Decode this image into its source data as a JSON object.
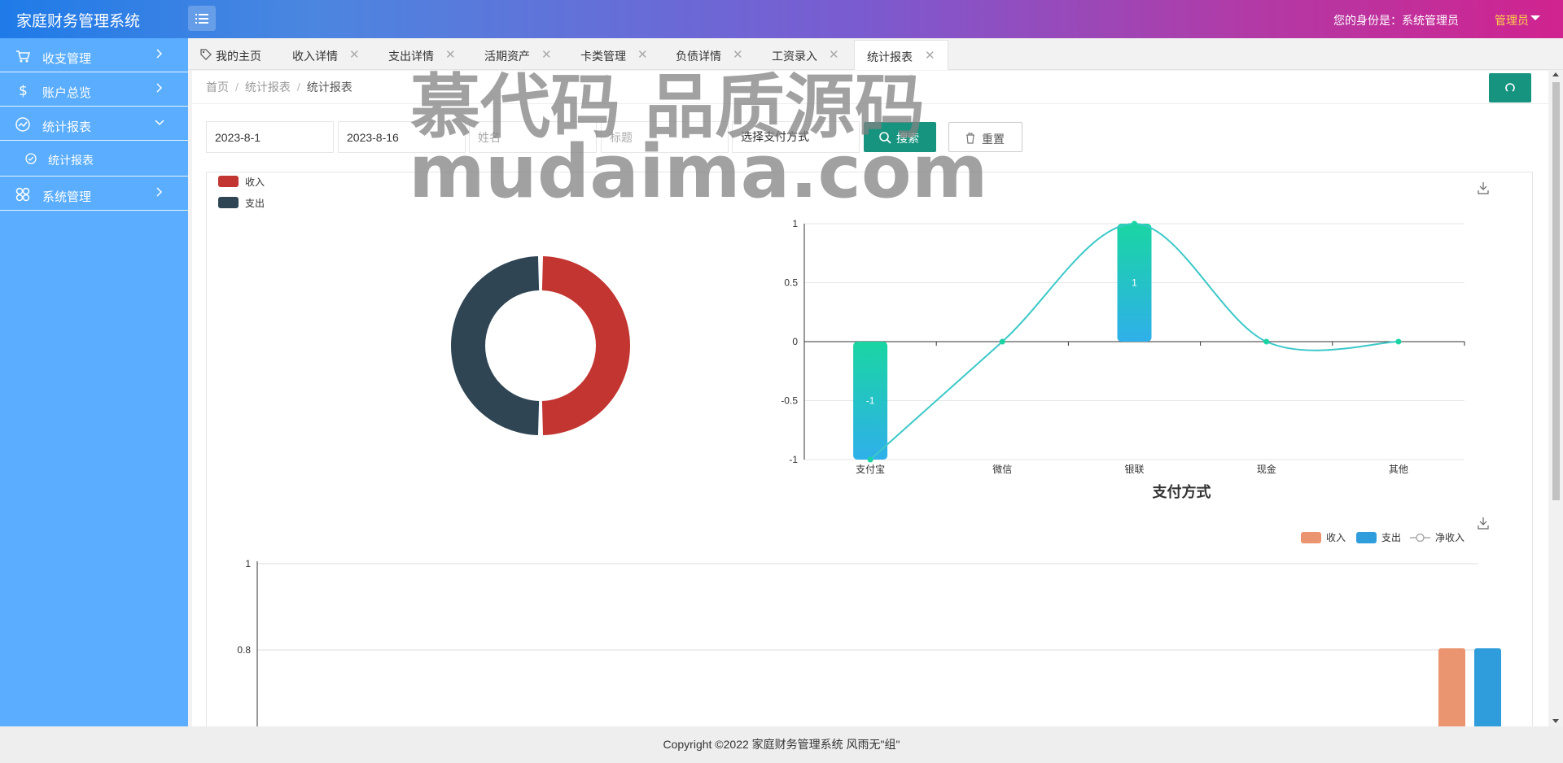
{
  "header": {
    "app_title": "家庭财务管理系统",
    "identity_text": "您的身份是：系统管理员",
    "user_menu": "管理员"
  },
  "sidebar": {
    "items": [
      {
        "label": "收支管理",
        "icon": "cart-icon"
      },
      {
        "label": "账户总览",
        "icon": "dollar-icon"
      },
      {
        "label": "统计报表",
        "icon": "trend-icon",
        "expanded": true,
        "children": [
          {
            "label": "统计报表",
            "icon": "check-circle-icon"
          }
        ]
      },
      {
        "label": "系统管理",
        "icon": "grid-icon"
      }
    ]
  },
  "tabs": [
    {
      "label": "我的主页",
      "closable": false,
      "icon": "tag-icon"
    },
    {
      "label": "收入详情",
      "closable": true
    },
    {
      "label": "支出详情",
      "closable": true
    },
    {
      "label": "活期资产",
      "closable": true
    },
    {
      "label": "卡类管理",
      "closable": true
    },
    {
      "label": "负债详情",
      "closable": true
    },
    {
      "label": "工资录入",
      "closable": true
    },
    {
      "label": "统计报表",
      "closable": true,
      "active": true
    }
  ],
  "close_glyph": "✕",
  "breadcrumb": {
    "items": [
      "首页",
      "统计报表",
      "统计报表"
    ],
    "separator": "/"
  },
  "filters": {
    "start_date": "2023-8-1",
    "end_date": "2023-8-16",
    "name_placeholder": "姓名",
    "title_placeholder": "标题",
    "pay_method": "选择支付方式",
    "search_label": "搜索",
    "reset_label": "重置"
  },
  "chart_data": [
    {
      "type": "pie",
      "subtype": "donut",
      "legend": [
        "收入",
        "支出"
      ],
      "legend_position": "top-left",
      "values": [
        1,
        1
      ],
      "colors": [
        "#c23531",
        "#2f4554"
      ]
    },
    {
      "type": "bar",
      "title": "支付方式",
      "categories": [
        "支付宝",
        "微信",
        "银联",
        "现金",
        "其他"
      ],
      "values": [
        -1,
        0,
        1,
        0,
        0
      ],
      "line_values": [
        -1,
        0,
        1,
        0,
        0
      ],
      "ylim": [
        -1,
        1
      ],
      "yticks": [
        "1",
        "0.5",
        "0",
        "-0.5",
        "-1"
      ],
      "bar_labels": [
        "-1",
        "",
        "1",
        "",
        ""
      ],
      "colors": {
        "bar_top": "#1ad5a3",
        "bar_bottom": "#2fb0ea",
        "line": "#3cc8c8"
      }
    },
    {
      "type": "bar",
      "legend": [
        "收入",
        "支出",
        "净收入"
      ],
      "legend_position": "top-right",
      "series": [
        {
          "name": "收入",
          "color": "#eb9470"
        },
        {
          "name": "支出",
          "color": "#2f9cdc"
        },
        {
          "name": "净收入",
          "type": "line"
        }
      ],
      "yticks": [
        "1",
        "0.8"
      ],
      "grid": true
    }
  ],
  "watermark": {
    "line1": "慕代码 品质源码",
    "line2": "mudaima.com"
  },
  "footer": {
    "text": "Copyright ©2022 家庭财务管理系统 风雨无\"组\""
  }
}
